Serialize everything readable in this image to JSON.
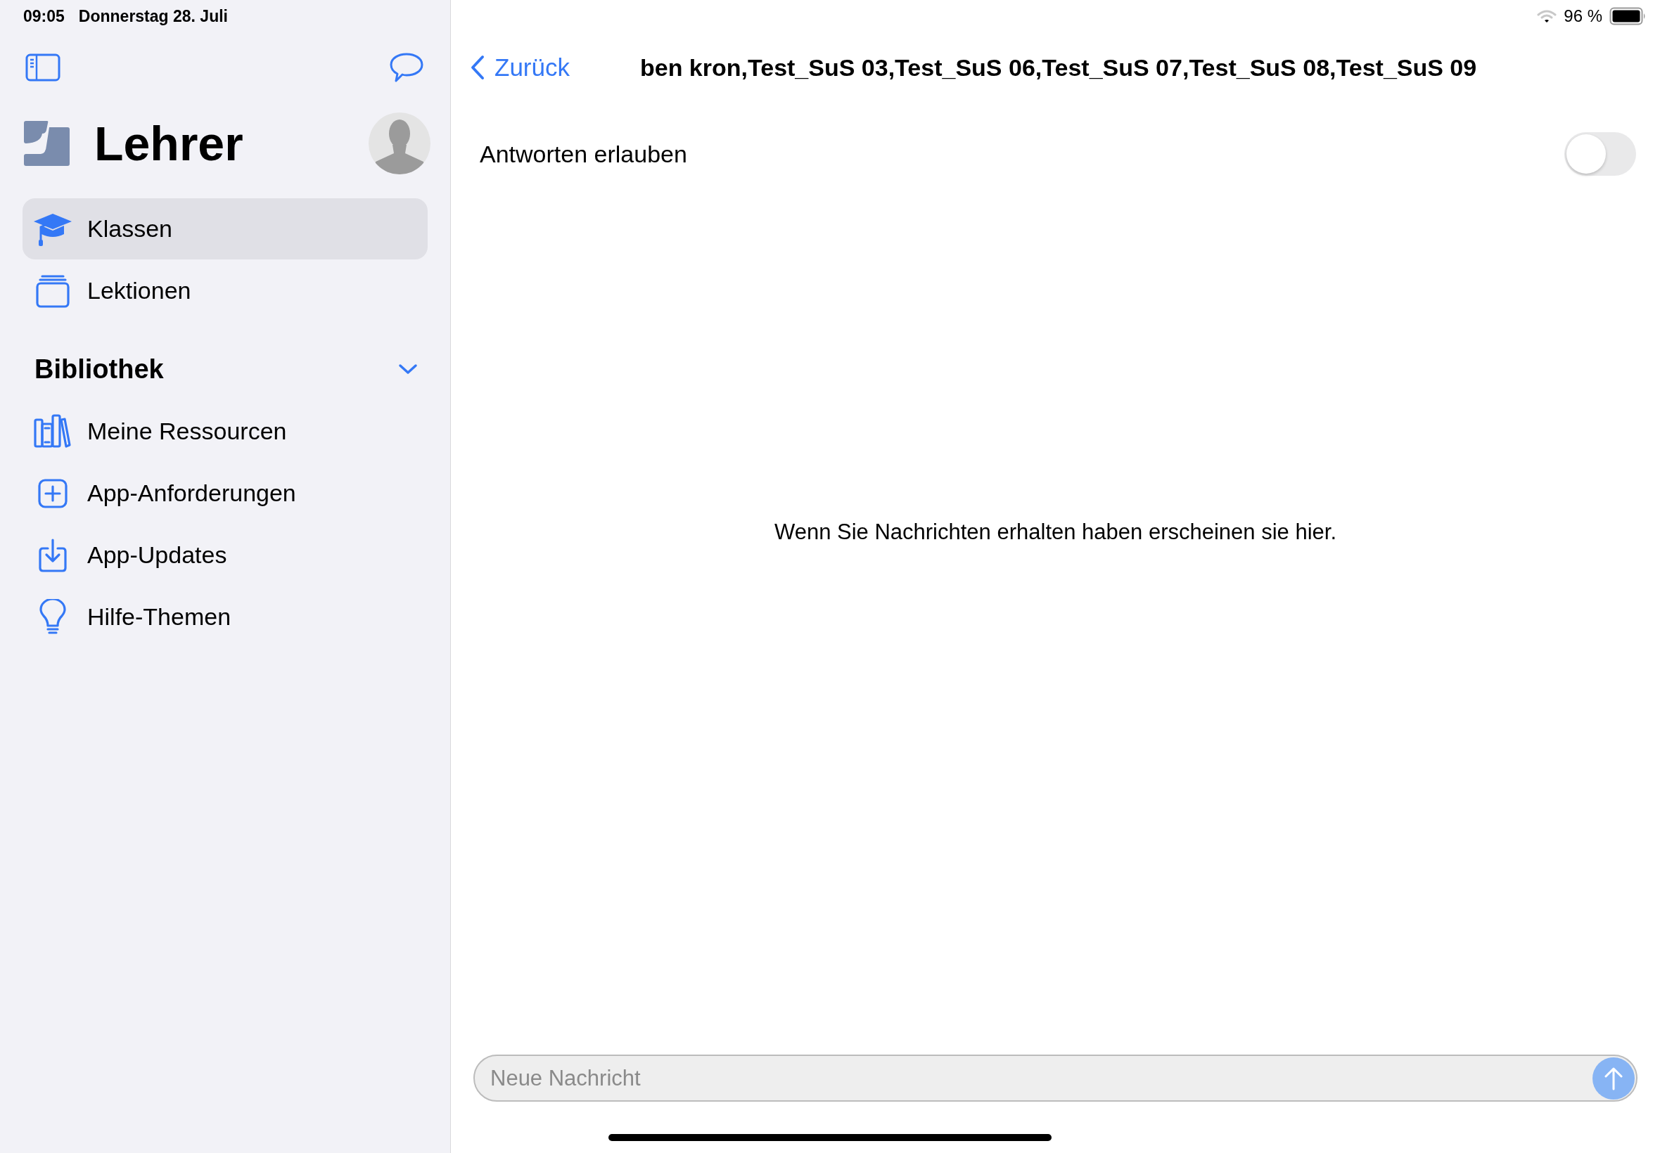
{
  "status_bar": {
    "time": "09:05",
    "date": "Donnerstag 28. Juli",
    "battery": "96 %"
  },
  "sidebar": {
    "title": "Lehrer",
    "items": [
      {
        "label": "Klassen",
        "kind": "cap",
        "selected": true
      },
      {
        "label": "Lektionen",
        "kind": "stack",
        "selected": false
      }
    ],
    "library": {
      "title": "Bibliothek",
      "expanded": true,
      "items": [
        {
          "label": "Meine Ressourcen",
          "kind": "books",
          "selected": false
        },
        {
          "label": "App-Anforderungen",
          "kind": "plus",
          "selected": false
        },
        {
          "label": "App-Updates",
          "kind": "download",
          "selected": false
        },
        {
          "label": "Hilfe-Themen",
          "kind": "bulb",
          "selected": false
        }
      ]
    }
  },
  "nav": {
    "back": "Zurück",
    "title": "ben kron,Test_SuS 03,Test_SuS 06,Test_SuS 07,Test_SuS 08,Test_SuS 09"
  },
  "reply_toggle": {
    "label": "Antworten erlauben",
    "on": false
  },
  "empty_message": "Wenn Sie Nachrichten erhalten haben erscheinen sie hier.",
  "composer": {
    "placeholder": "Neue Nachricht"
  }
}
